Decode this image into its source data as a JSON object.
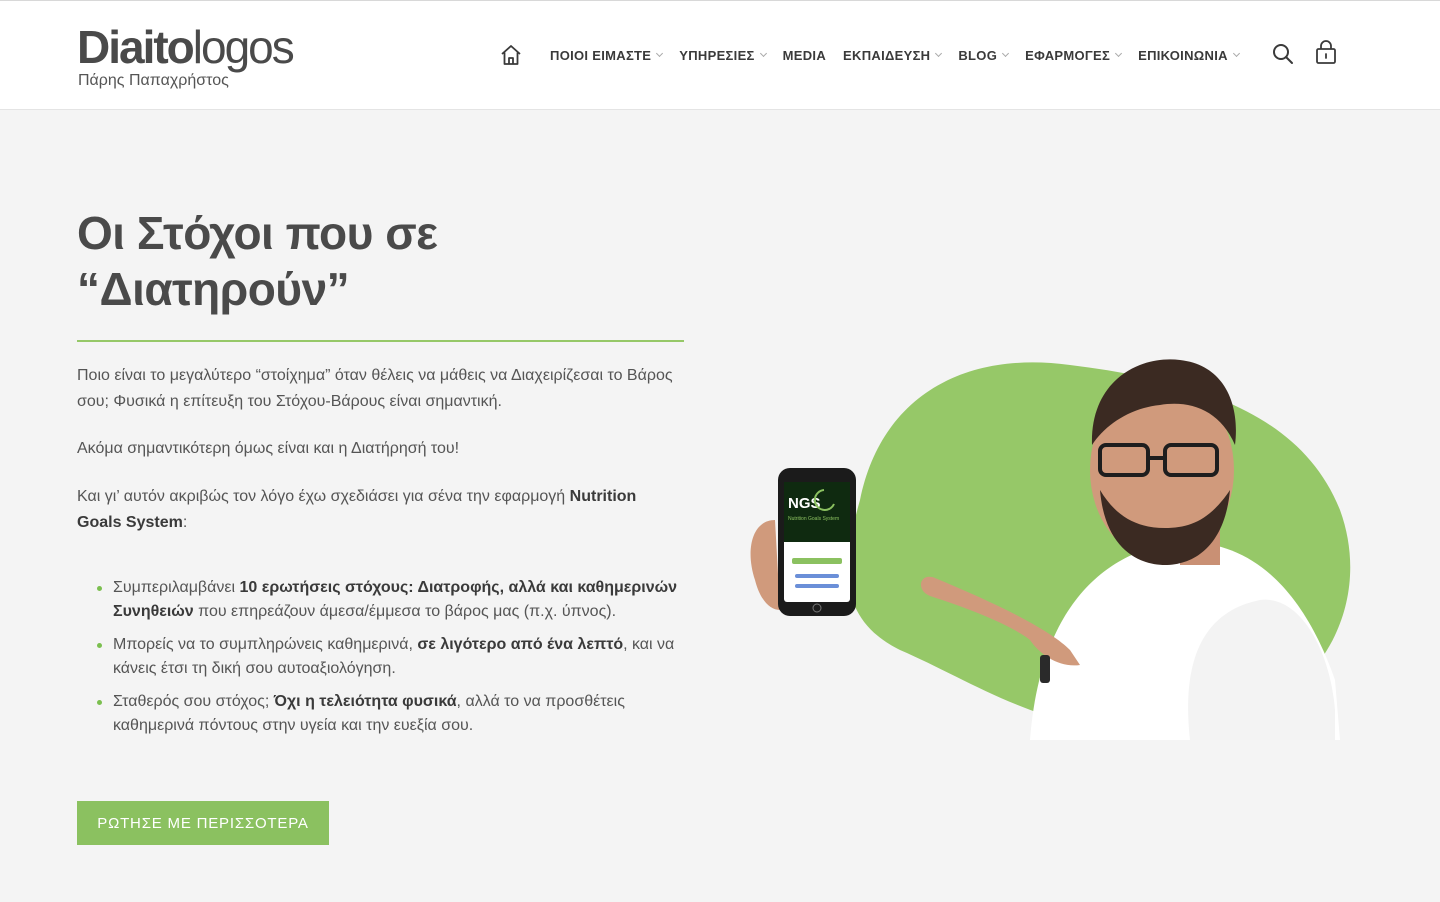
{
  "header": {
    "logo_text_a": "Diaito",
    "logo_text_b": "logos",
    "logo_subtitle": "Πάρης Παπαχρήστος",
    "nav": [
      {
        "label": "ΠΟΙΟΙ ΕΙΜΑΣΤΕ",
        "has_dropdown": true
      },
      {
        "label": "ΥΠΗΡΕΣΙΕΣ",
        "has_dropdown": true
      },
      {
        "label": "MEDIA",
        "has_dropdown": false
      },
      {
        "label": "ΕΚΠΑΙΔΕΥΣΗ",
        "has_dropdown": true
      },
      {
        "label": "BLOG",
        "has_dropdown": true
      },
      {
        "label": "ΕΦΑΡΜΟΓΕΣ",
        "has_dropdown": true
      },
      {
        "label": "ΕΠΙΚΟΙΝΩΝΙΑ",
        "has_dropdown": true
      }
    ],
    "icons": [
      "home-icon",
      "search-icon",
      "cart-lock-icon"
    ]
  },
  "hero": {
    "title_line1": "Οι Στόχοι που σε",
    "title_line2": "“Διατηρούν”",
    "p1": "Ποιο είναι το μεγαλύτερο “στοίχημα” όταν θέλεις να μάθεις να Διαχειρίζεσαι το Βάρος σου; Φυσικά η επίτευξη του Στόχου-Βάρους είναι σημαντική.",
    "p2": "Ακόμα σημαντικότερη όμως είναι και η Διατήρησή του!",
    "p3_text": "Και γι’ αυτόν ακριβώς τον λόγο έχω σχεδιάσει για σένα την εφαρμογή ",
    "p3_strong": "Nutrition Goals System",
    "p3_end": ":",
    "bullets": [
      {
        "pre": "Συμπεριλαμβάνει ",
        "strong": "10 ερωτήσεις στόχους: Διατροφής, αλλά και καθημερινών Συνηθειών",
        "post": " που επηρεάζουν άμεσα/έμμεσα το βάρος μας (π.χ. ύπνος)."
      },
      {
        "pre": "Μπορείς να το συμπληρώνεις καθημερινά, ",
        "strong": "σε λιγότερο από ένα λεπτό",
        "post": ", και να κάνεις έτσι τη δική σου αυτοαξιολόγηση."
      },
      {
        "pre": "Σταθερός σου στόχος; ",
        "strong": "Όχι η τελειότητα φυσικά",
        "post": ", αλλά το να προσθέτεις καθημερινά πόντους στην υγεία και την ευεξία σου."
      }
    ],
    "cta_label": "ΡΩΤΗΣΕ ΜΕ ΠΕΡΙΣΣΟΤΕΡΑ",
    "phone_brand": "NGS",
    "phone_subtitle": "Nutrition Goals System"
  },
  "colors": {
    "accent_green": "#8bc160",
    "blob_green": "#96c868",
    "text_dark": "#3a3a3a",
    "background": "#f4f4f4"
  }
}
